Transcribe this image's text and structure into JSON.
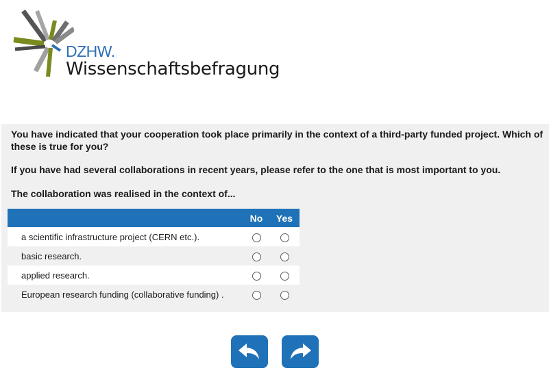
{
  "logo": {
    "brand": "DZHW.",
    "subtitle": "Wissenschaftsbefragung"
  },
  "question": {
    "text": "You have indicated that your cooperation took place primarily in the context of a third-party funded project. Which of these is true for you?",
    "instruction": "If you have had several collaborations in recent years, please refer to the one that is most important to you.",
    "stem": "The collaboration was realised in the context of..."
  },
  "grid": {
    "columns": [
      "No",
      "Yes"
    ],
    "rows": [
      {
        "label": "a scientific infrastructure project (CERN etc.)."
      },
      {
        "label": "basic research."
      },
      {
        "label": "applied research."
      },
      {
        "label": "European research funding (collaborative funding) ."
      }
    ]
  },
  "nav": {
    "back_icon": "arrow-back-icon",
    "next_icon": "arrow-forward-icon"
  },
  "colors": {
    "accent": "#1f72b8",
    "panel": "#f0f0f0",
    "brand_blue": "#2d6fb5",
    "olive": "#7a8a1e"
  }
}
